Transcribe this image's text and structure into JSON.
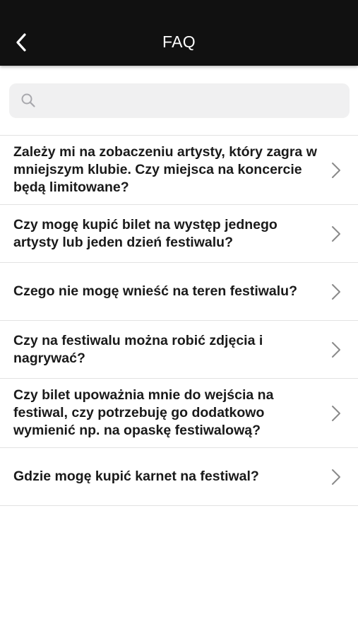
{
  "header": {
    "title": "FAQ",
    "back_icon": "chevron-left-icon"
  },
  "search": {
    "icon": "search-icon",
    "placeholder": "",
    "value": ""
  },
  "faq": {
    "items": [
      {
        "question": "Zależy mi na zobaczeniu artysty, który zagra w mniejszym klubie. Czy miejsca na koncercie będą limitowane?"
      },
      {
        "question": "Czy mogę kupić bilet na występ jednego artysty lub jeden dzień festiwalu?"
      },
      {
        "question": "Czego nie mogę wnieść na teren festiwalu?"
      },
      {
        "question": "Czy na festiwalu można robić zdjęcia i nagrywać?"
      },
      {
        "question": "Czy bilet upoważnia mnie do wejścia na festiwal, czy potrzebuję go dodatkowo wymienić np. na opaskę festiwalową?"
      },
      {
        "question": "Gdzie mogę kupić karnet na festiwal?"
      }
    ]
  },
  "colors": {
    "header_bg": "#111111",
    "header_text": "#ffffff",
    "search_bg": "#f0f0f1",
    "divider": "#e2e2e2",
    "question_text": "#1a1a1a",
    "chevron": "#8a8a8a"
  }
}
